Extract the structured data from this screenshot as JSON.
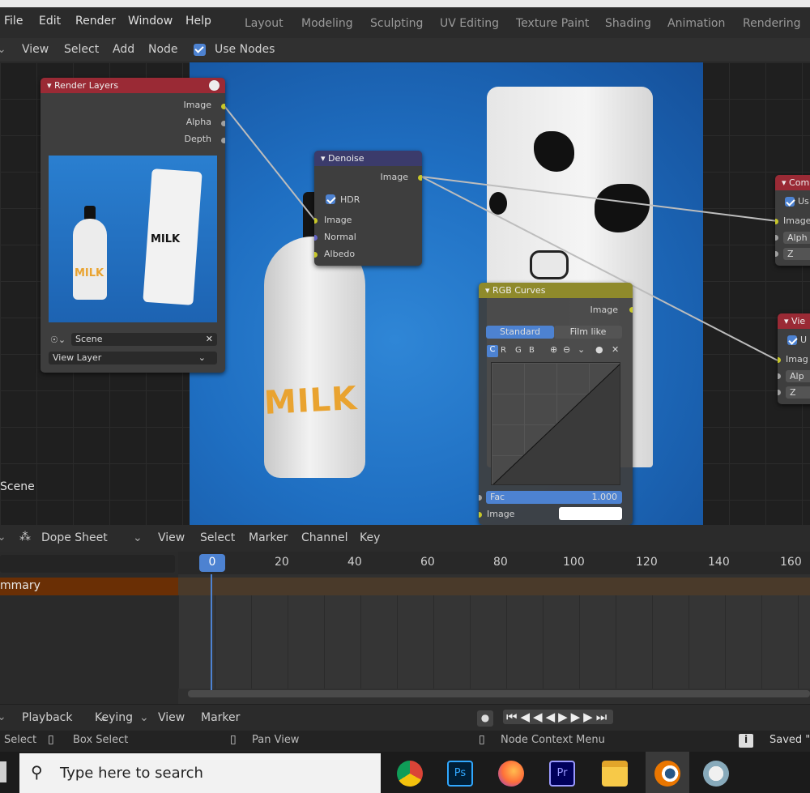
{
  "menu": [
    "File",
    "Edit",
    "Render",
    "Window",
    "Help"
  ],
  "workspaces": [
    "Layout",
    "Modeling",
    "Sculpting",
    "UV Editing",
    "Texture Paint",
    "Shading",
    "Animation",
    "Rendering"
  ],
  "node_header": {
    "items": [
      "View",
      "Select",
      "Add",
      "Node"
    ],
    "use_nodes": "Use Nodes"
  },
  "render_layers": {
    "title": "Render Layers",
    "outputs": [
      "Image",
      "Alpha",
      "Depth"
    ],
    "preview_bottle": "MILK",
    "preview_carton": "MILK",
    "scene_value": "Scene",
    "view_layer_value": "View Layer"
  },
  "denoise": {
    "title": "Denoise",
    "output": "Image",
    "hdr": "HDR",
    "inputs": [
      "Image",
      "Normal",
      "Albedo"
    ]
  },
  "rgb_curves": {
    "title": "RGB Curves",
    "output": "Image",
    "modes": [
      "Standard",
      "Film like"
    ],
    "channels": [
      "C",
      "R",
      "G",
      "B"
    ],
    "fac_label": "Fac",
    "fac_value": "1.000",
    "image_label": "Image"
  },
  "composite": {
    "title": "Com",
    "use": "Us",
    "inputs": [
      "Image",
      "Alph",
      "Z"
    ]
  },
  "viewer": {
    "title": "Vie",
    "use": "U",
    "inputs": [
      "Imag",
      "Alp",
      "Z"
    ]
  },
  "backdrop": {
    "bottle_text": "MILK",
    "carton_text": "MILK"
  },
  "canvas_label": "Scene",
  "dopesheet": {
    "mode": "Dope Sheet",
    "menu": [
      "View",
      "Select",
      "Marker",
      "Channel",
      "Key"
    ],
    "summary": "mmary",
    "current_frame": "0",
    "frames": [
      "20",
      "40",
      "60",
      "80",
      "100",
      "120",
      "140",
      "160"
    ]
  },
  "playback": {
    "items": [
      "Playback",
      "Keying",
      "View",
      "Marker"
    ]
  },
  "status": {
    "select": "Select",
    "box_select": "Box Select",
    "pan_view": "Pan View",
    "context_menu": "Node Context Menu",
    "saved": "Saved \""
  },
  "taskbar": {
    "search_placeholder": "Type here to search"
  },
  "colors": {
    "accent": "#4d82d1",
    "render_layers_header": "#9a2a35",
    "denoise_header": "#3b3b6b",
    "curves_header": "#8f8a2b",
    "socket_image": "#c7c729"
  }
}
